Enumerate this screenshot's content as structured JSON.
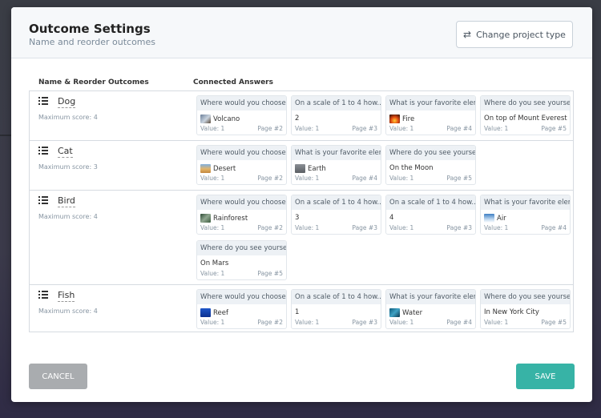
{
  "header": {
    "title": "Outcome Settings",
    "subtitle": "Name and reorder outcomes",
    "change_type_label": "Change project type"
  },
  "columns": {
    "outcomes": "Name & Reorder Outcomes",
    "answers": "Connected Answers"
  },
  "outcomes": [
    {
      "name": "Dog",
      "max_score": "Maximum score: 4",
      "answers": [
        {
          "question": "Where would you choose to live?",
          "answer": "Volcano",
          "thumb": "volcano",
          "value": "Value: 1",
          "page": "Page #2"
        },
        {
          "question": "On a scale of 1 to 4 how...",
          "answer": "2",
          "thumb": null,
          "value": "Value: 1",
          "page": "Page #3"
        },
        {
          "question": "What is your favorite element?",
          "answer": "Fire",
          "thumb": "fire",
          "value": "Value: 1",
          "page": "Page #4"
        },
        {
          "question": "Where do you see yourself?",
          "answer": "On top of Mount Everest",
          "thumb": null,
          "value": "Value: 1",
          "page": "Page #5"
        }
      ]
    },
    {
      "name": "Cat",
      "max_score": "Maximum score: 3",
      "answers": [
        {
          "question": "Where would you choose to live?",
          "answer": "Desert",
          "thumb": "desert",
          "value": "Value: 1",
          "page": "Page #2"
        },
        {
          "question": "What is your favorite element?",
          "answer": "Earth",
          "thumb": "earth",
          "value": "Value: 1",
          "page": "Page #4"
        },
        {
          "question": "Where do you see yourself?",
          "answer": "On the Moon",
          "thumb": null,
          "value": "Value: 1",
          "page": "Page #5"
        }
      ]
    },
    {
      "name": "Bird",
      "max_score": "Maximum score: 4",
      "answers": [
        {
          "question": "Where would you choose to live?",
          "answer": "Rainforest",
          "thumb": "rainforest",
          "value": "Value: 1",
          "page": "Page #2"
        },
        {
          "question": "On a scale of 1 to 4 how...",
          "answer": "3",
          "thumb": null,
          "value": "Value: 1",
          "page": "Page #3"
        },
        {
          "question": "On a scale of 1 to 4 how...",
          "answer": "4",
          "thumb": null,
          "value": "Value: 1",
          "page": "Page #3"
        },
        {
          "question": "What is your favorite element?",
          "answer": "Air",
          "thumb": "air",
          "value": "Value: 1",
          "page": "Page #4"
        },
        {
          "question": "Where do you see yourself?",
          "answer": "On Mars",
          "thumb": null,
          "value": "Value: 1",
          "page": "Page #5"
        }
      ]
    },
    {
      "name": "Fish",
      "max_score": "Maximum score: 4",
      "answers": [
        {
          "question": "Where would you choose to live?",
          "answer": "Reef",
          "thumb": "reef",
          "value": "Value: 1",
          "page": "Page #2"
        },
        {
          "question": "On a scale of 1 to 4 how...",
          "answer": "1",
          "thumb": null,
          "value": "Value: 1",
          "page": "Page #3"
        },
        {
          "question": "What is your favorite element?",
          "answer": "Water",
          "thumb": "water",
          "value": "Value: 1",
          "page": "Page #4"
        },
        {
          "question": "Where do you see yourself?",
          "answer": "In New York City",
          "thumb": null,
          "value": "Value: 1",
          "page": "Page #5"
        }
      ]
    }
  ],
  "footer": {
    "cancel_label": "CANCEL",
    "save_label": "SAVE"
  },
  "colors": {
    "save": "#37b3a6",
    "cancel": "#a9acaf"
  }
}
